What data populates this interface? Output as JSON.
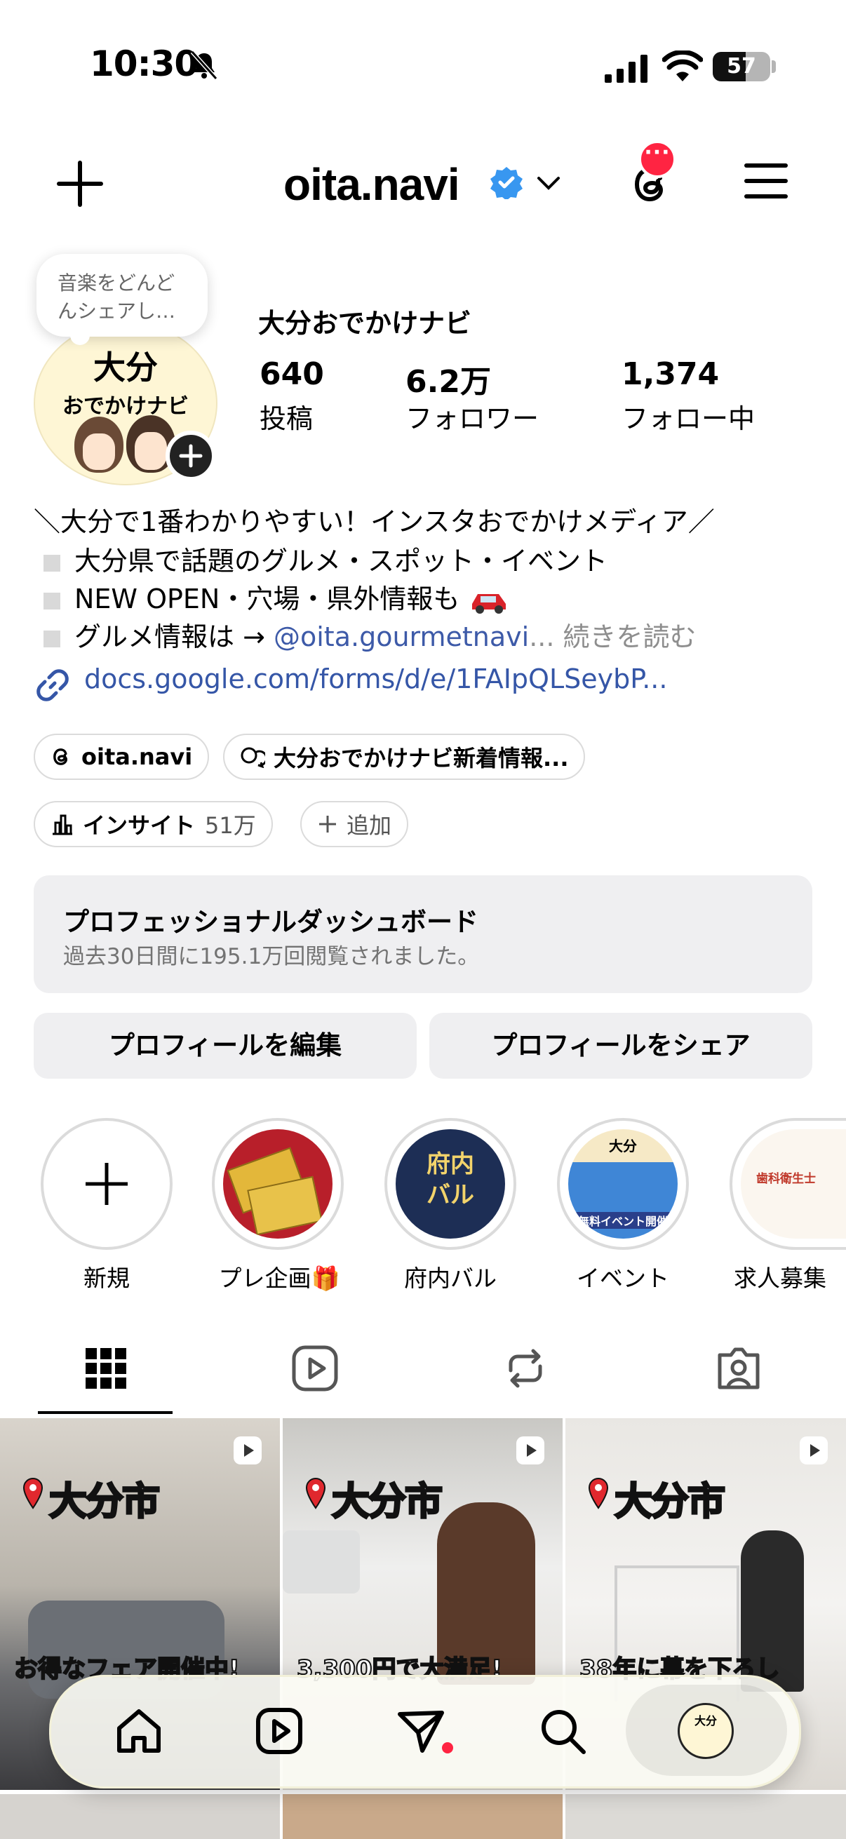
{
  "status_bar": {
    "time": "10:30",
    "battery": "57"
  },
  "header": {
    "username": "oita.navi"
  },
  "profile": {
    "note": "音楽をどんどんシェアし…",
    "avatar_line1": "大分",
    "avatar_line2": "おでかけナビ",
    "display_name": "大分おでかけナビ",
    "stats": [
      {
        "value": "640",
        "label": "投稿"
      },
      {
        "value": "6.2万",
        "label": "フォロワー"
      },
      {
        "value": "1,374",
        "label": "フォロー中"
      }
    ]
  },
  "bio": {
    "line1": "＼大分で1番わかりやすい！インスタおでかけメディア／",
    "line2": "大分県で話題のグルメ・スポット・イベント",
    "line3": "NEW OPEN・穴場・県外情報も",
    "line4_prefix": "グルメ情報は → ",
    "line4_mention": "@oita.gourmetnavi",
    "line4_more": "... 続きを読む",
    "link": "docs.google.com/forms/d/e/1FAIpQLSeybP..."
  },
  "chips": {
    "threads": "oita.navi",
    "channel": "大分おでかけナビ新着情報...",
    "insight": "インサイト",
    "insight_value": "51万",
    "add": "追加"
  },
  "dashboard": {
    "title": "プロフェッショナルダッシュボード",
    "subtitle": "過去30日間に195.1万回閲覧されました。"
  },
  "buttons": {
    "edit": "プロフィールを編集",
    "share": "プロフィールをシェア"
  },
  "highlights": [
    {
      "label": "新規"
    },
    {
      "label": "プレ企画🎁"
    },
    {
      "label": "府内バル"
    },
    {
      "label": "イベント"
    },
    {
      "label": "求人募集"
    }
  ],
  "highlight_art": {
    "bar_text": "府内バル",
    "event_city": "大分",
    "event_text": "無料イベント開催",
    "job_text": "歯科衛生士"
  },
  "posts": [
    {
      "label": "大分市",
      "caption": "お得なフェア開催中!"
    },
    {
      "label": "大分市",
      "caption": "3,300円で大満足!"
    },
    {
      "label": "大分市",
      "caption": "38年に幕を下ろし"
    }
  ],
  "colors": {
    "accent": "#3d5aa8",
    "badge": "#ff2442",
    "verified": "#3897f0"
  }
}
